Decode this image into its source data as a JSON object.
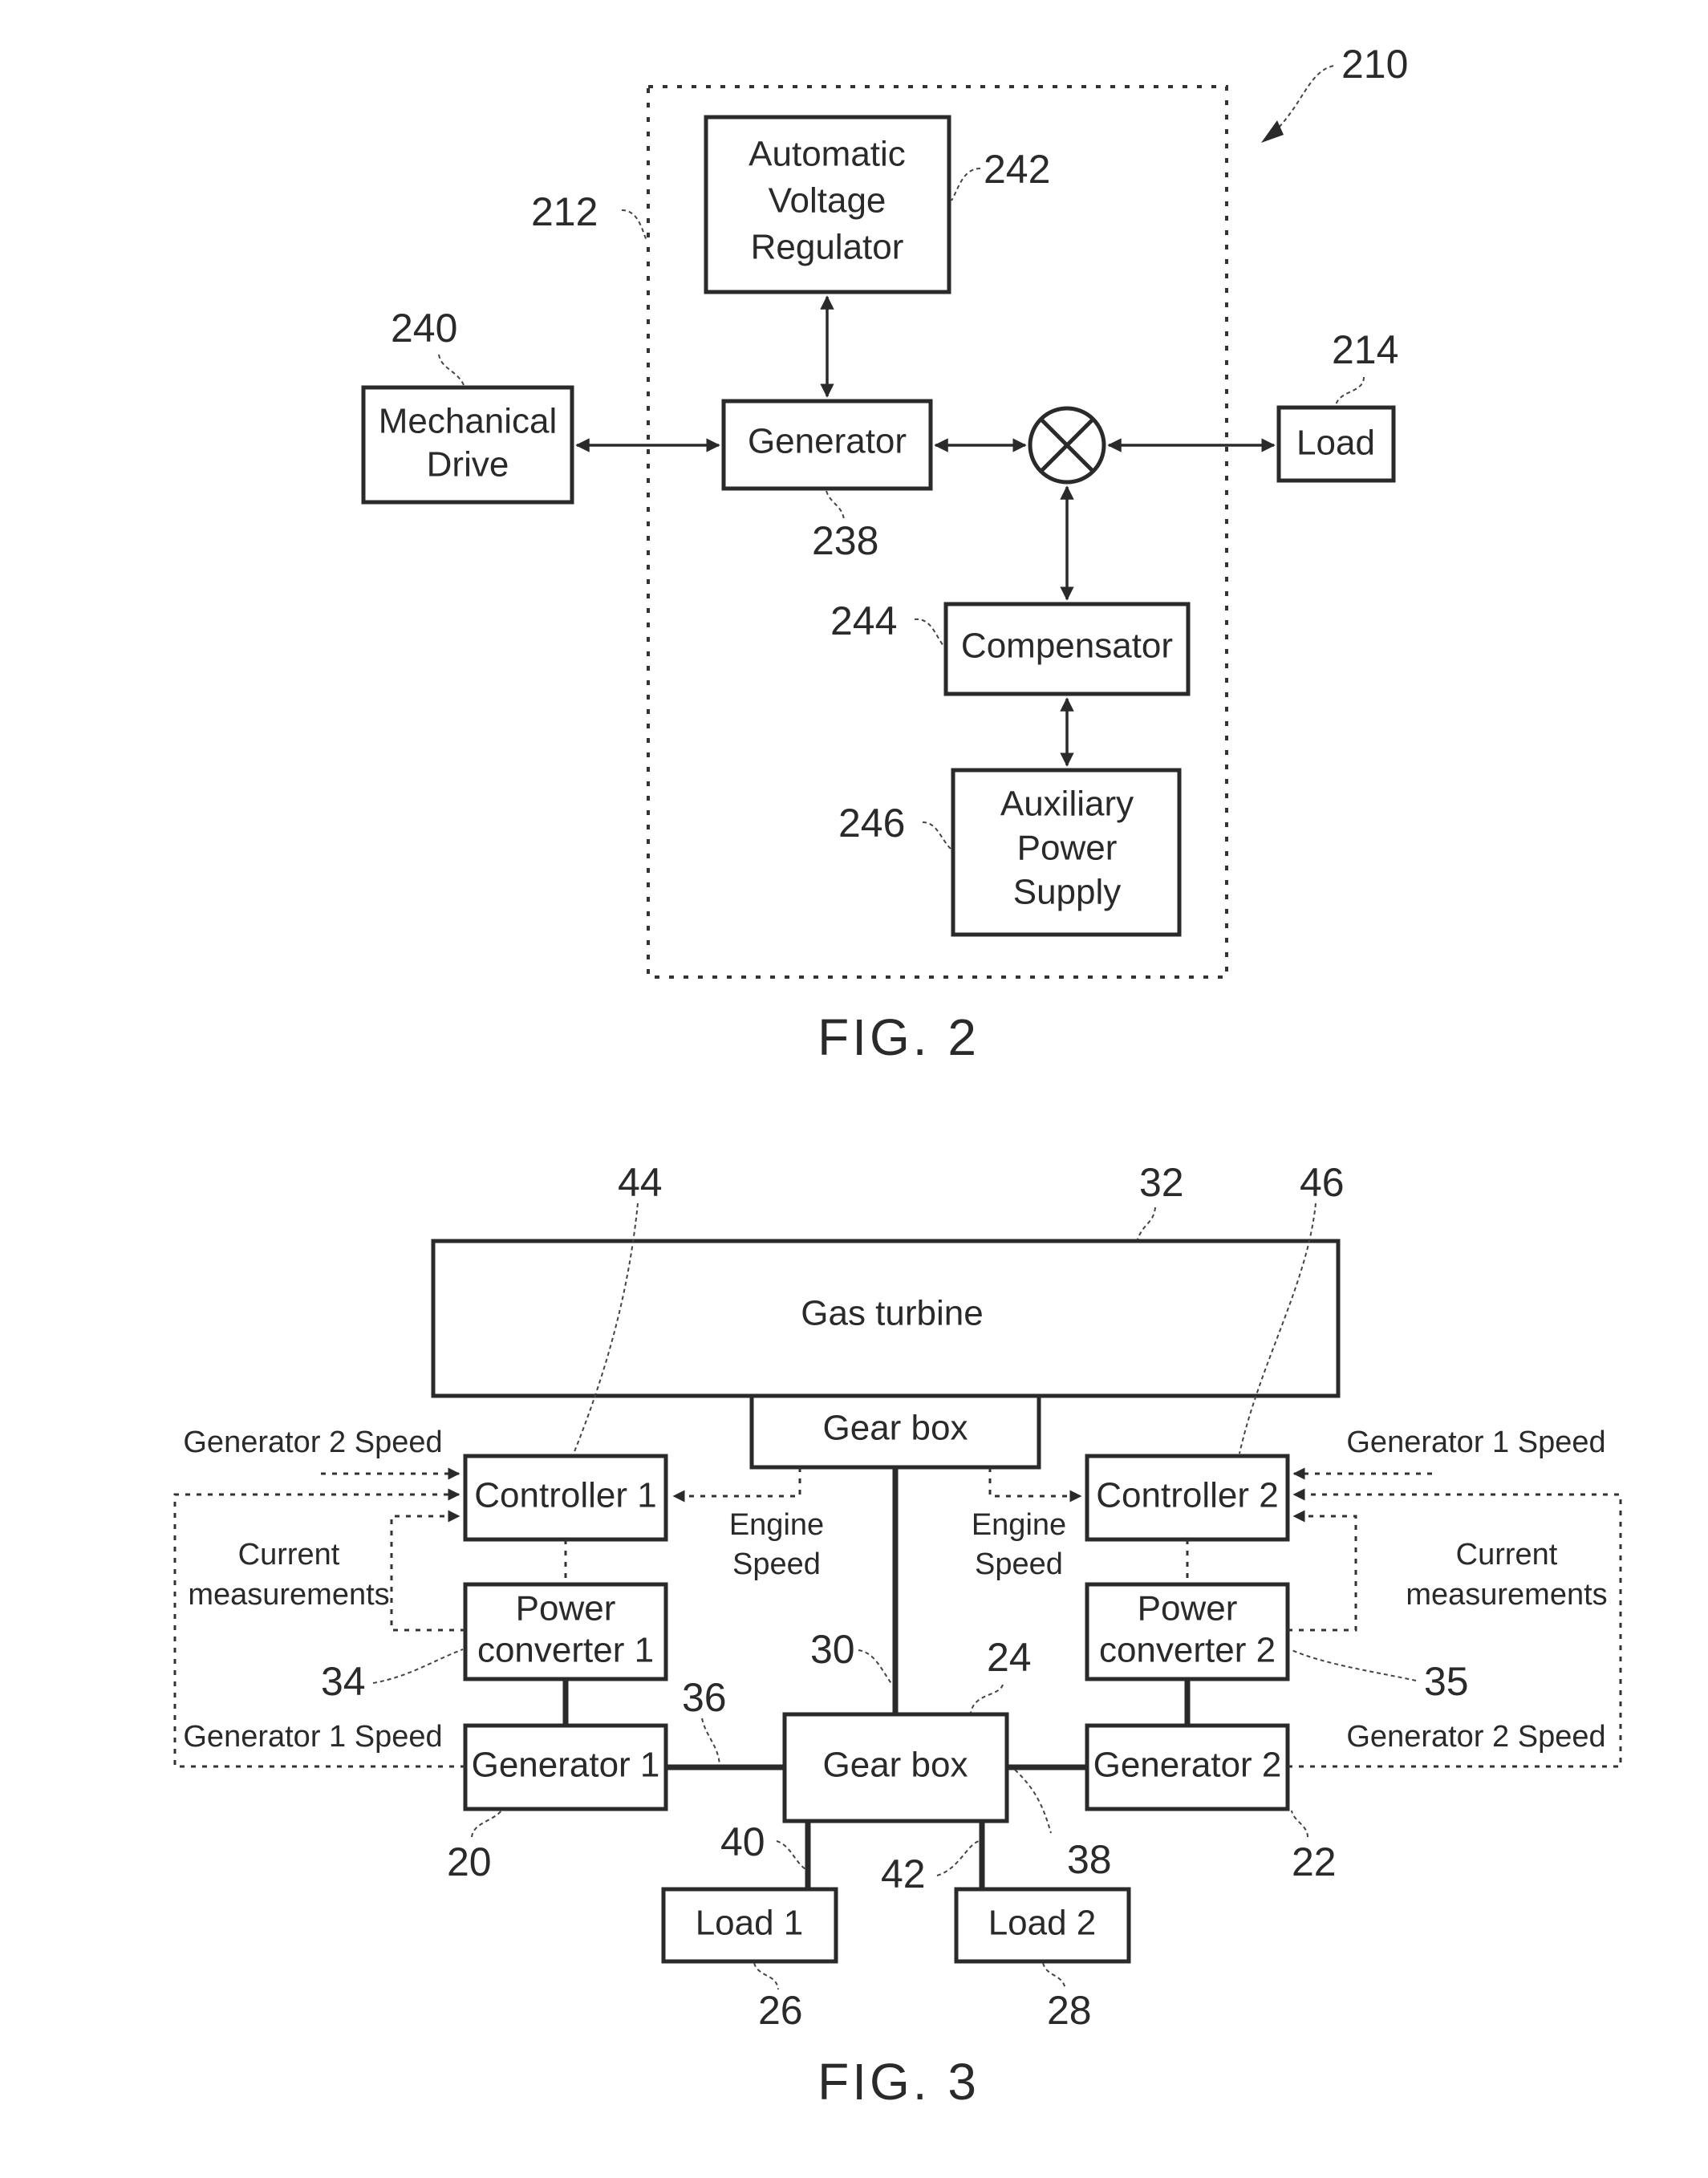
{
  "fig2": {
    "caption": "FIG. 2",
    "refs": {
      "system": "210",
      "boundary": "212",
      "load": "214",
      "generator": "238",
      "mechanical_drive": "240",
      "avr": "242",
      "compensator": "244",
      "aux_power": "246"
    },
    "blocks": {
      "avr": [
        "Automatic",
        "Voltage",
        "Regulator"
      ],
      "generator": "Generator",
      "mechanical_drive": [
        "Mechanical",
        "Drive"
      ],
      "load": "Load",
      "compensator": "Compensator",
      "aux_power": [
        "Auxiliary",
        "Power",
        "Supply"
      ]
    },
    "junction_symbol": "summing-junction"
  },
  "fig3": {
    "caption": "FIG. 3",
    "refs": {
      "gas_turbine": "32",
      "controller1": "44",
      "controller2": "46",
      "power_converter1": "34",
      "power_converter2": "35",
      "generator1": "20",
      "generator2": "22",
      "gearbox": "24",
      "shaft": "30",
      "gen1_shaft": "36",
      "gen2_shaft": "38",
      "load1_shaft": "40",
      "load2_shaft": "42",
      "load1": "26",
      "load2": "28"
    },
    "blocks": {
      "gas_turbine": "Gas turbine",
      "top_gearbox": "Gear box",
      "gearbox": "Gear box",
      "controller1": "Controller 1",
      "controller2": "Controller 2",
      "power_converter1": [
        "Power",
        "converter 1"
      ],
      "power_converter2": [
        "Power",
        "converter 2"
      ],
      "generator1": "Generator 1",
      "generator2": "Generator 2",
      "load1": "Load 1",
      "load2": "Load 2"
    },
    "signals": {
      "gen2_speed_left": "Generator 2 Speed",
      "gen1_speed_left": "Generator 1 Speed",
      "gen1_speed_right": "Generator 1 Speed",
      "gen2_speed_right": "Generator 2 Speed",
      "current_meas_left": [
        "Current",
        "measurements"
      ],
      "current_meas_right": [
        "Current",
        "measurements"
      ],
      "engine_speed_left": [
        "Engine",
        "Speed"
      ],
      "engine_speed_right": [
        "Engine",
        "Speed"
      ]
    }
  }
}
